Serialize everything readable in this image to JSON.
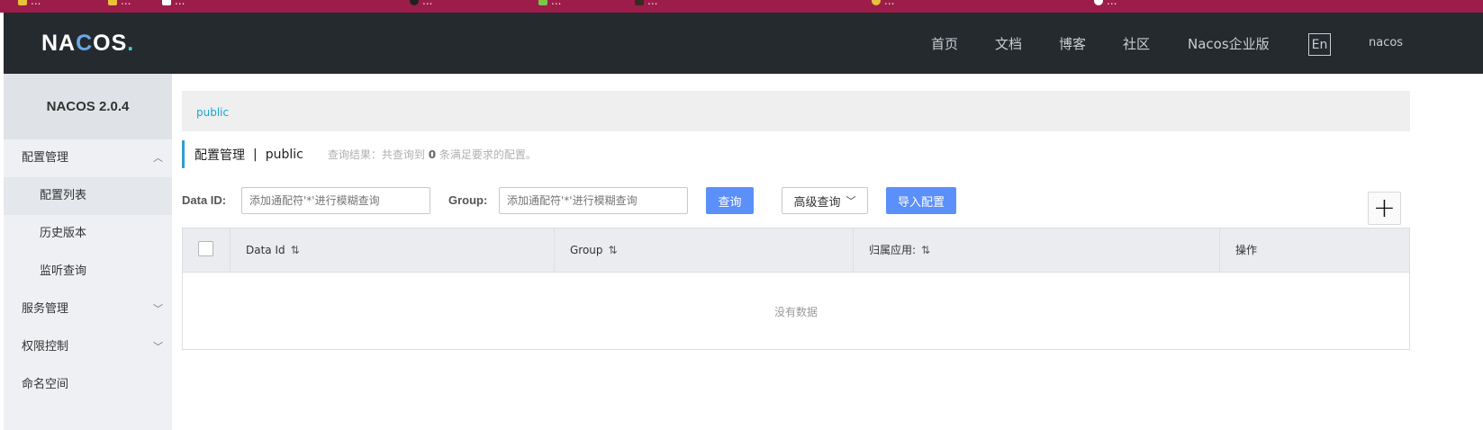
{
  "browser": {
    "bookmarks": [
      "...",
      "...",
      "...",
      "...",
      "...",
      "...",
      "...",
      "..."
    ]
  },
  "topnav": {
    "logo": {
      "pre": "NA",
      "o": "C",
      "mid": "OS",
      "dot": "."
    },
    "items": [
      "首页",
      "文档",
      "博客",
      "社区",
      "Nacos企业版"
    ],
    "lang": "En",
    "user": "nacos"
  },
  "sidebar": {
    "title": "NACOS 2.0.4",
    "items": [
      {
        "label": "配置管理",
        "chevron": "up"
      },
      {
        "label": "配置列表"
      },
      {
        "label": "历史版本"
      },
      {
        "label": "监听查询"
      },
      {
        "label": "服务管理",
        "chevron": "down"
      },
      {
        "label": "权限控制",
        "chevron": "down"
      },
      {
        "label": "命名空间"
      }
    ]
  },
  "namespace": {
    "current": "public"
  },
  "page": {
    "title": "配置管理",
    "sep": "|",
    "namespace": "public",
    "result_pre": "查询结果：共查询到",
    "result_count": "0",
    "result_post": "条满足要求的配置。"
  },
  "filters": {
    "dataid_label": "Data ID:",
    "dataid_placeholder": "添加通配符'*'进行模糊查询",
    "group_label": "Group:",
    "group_placeholder": "添加通配符'*'进行模糊查询",
    "query_btn": "查询",
    "advanced_btn": "高级查询",
    "import_btn": "导入配置",
    "add_btn": "+"
  },
  "table": {
    "columns": [
      "Data Id",
      "Group",
      "归属应用:",
      "操作"
    ],
    "empty": "没有数据"
  },
  "colors": {
    "nav_bg": "#252a2f",
    "primary": "#5b8ff9",
    "accent_link": "#1ea3cf",
    "bookmark_bar": "#9c1d4a"
  }
}
